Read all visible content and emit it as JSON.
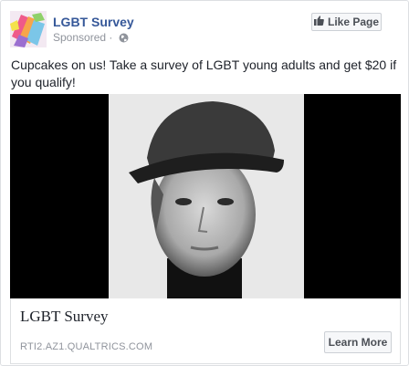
{
  "post": {
    "page_name": "LGBT Survey",
    "sponsored_label": "Sponsored",
    "sponsored_separator": " · ",
    "like_button_label": "Like Page",
    "text": "Cupcakes on us! Take a survey of LGBT young adults and get $20 if you qualify!"
  },
  "link": {
    "title": "LGBT Survey",
    "domain": "RTI2.AZ1.QUALTRICS.COM",
    "cta_label": "Learn More"
  },
  "icons": {
    "globe": "globe-icon",
    "like": "thumbs-up-icon"
  },
  "colors": {
    "page_name": "#365899",
    "muted_text": "#90949c",
    "button_bg": "#f6f7f9"
  }
}
